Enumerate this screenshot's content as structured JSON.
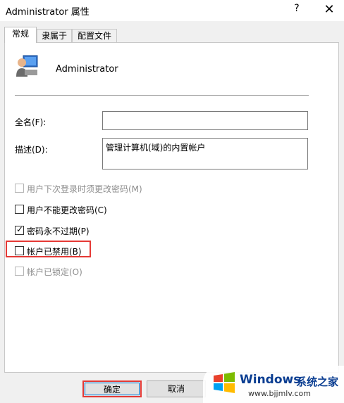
{
  "window": {
    "title": "Administrator 属性",
    "help": "?",
    "close": "✕"
  },
  "tabs": [
    {
      "label": "常规",
      "active": true
    },
    {
      "label": "隶属于",
      "active": false
    },
    {
      "label": "配置文件",
      "active": false
    }
  ],
  "user": {
    "name": "Administrator",
    "icon": "user-icon"
  },
  "fields": {
    "fullname_label": "全名(F):",
    "fullname_value": "",
    "description_label": "描述(D):",
    "description_value": "管理计算机(域)的内置帐户"
  },
  "checkboxes": [
    {
      "label": "用户下次登录时须更改密码(M)",
      "checked": false,
      "disabled": true
    },
    {
      "label": "用户不能更改密码(C)",
      "checked": false,
      "disabled": false
    },
    {
      "label": "密码永不过期(P)",
      "checked": true,
      "disabled": false
    },
    {
      "label": "帐户已禁用(B)",
      "checked": false,
      "disabled": false
    },
    {
      "label": "帐户已锁定(O)",
      "checked": false,
      "disabled": true
    }
  ],
  "buttons": {
    "ok": "确定",
    "cancel": "取消"
  },
  "watermark": {
    "brand": "Windows",
    "brand_cn": "系统之家",
    "url": "www.bjjmlv.com"
  },
  "colors": {
    "highlight": "#e53935",
    "focus": "#0078d7"
  }
}
